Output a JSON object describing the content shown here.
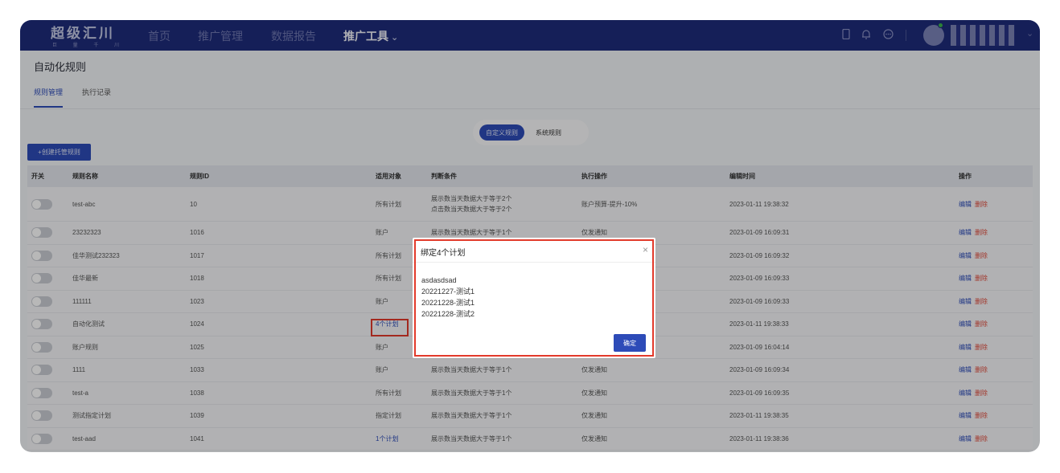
{
  "logo": {
    "main": "超级汇川",
    "sub": "巨 量 千 川"
  },
  "nav": {
    "items": [
      "首页",
      "推广管理",
      "数据报告"
    ],
    "active": "推广工具",
    "chevron": "chevron-down-icon"
  },
  "page": {
    "title": "自动化规则"
  },
  "subtabs": [
    "规则管理",
    "执行记录"
  ],
  "segment": {
    "custom": "自定义规则",
    "system": "系统规则"
  },
  "create_button": "+创建托管规则",
  "table": {
    "headers": [
      "开关",
      "规则名称",
      "规则ID",
      "适用对象",
      "判断条件",
      "执行操作",
      "编辑时间",
      "操作"
    ],
    "rows": [
      {
        "name": "test-abc",
        "id": "10",
        "target": "所有计划",
        "cond": [
          "展示数当天数据大于等于2个",
          "点击数当天数据大于等于2个"
        ],
        "action": "账户预算-提升-10%",
        "time": "2023-01-11 19:38:32"
      },
      {
        "name": "23232323",
        "id": "1016",
        "target": "账户",
        "cond": [
          "展示数当天数据大于等于1个"
        ],
        "action": "仅发通知",
        "time": "2023-01-09 16:09:31"
      },
      {
        "name": "佳华测试232323",
        "id": "1017",
        "target": "所有计划",
        "cond": [
          ""
        ],
        "action": "",
        "time": "2023-01-09 16:09:32"
      },
      {
        "name": "佳华最新",
        "id": "1018",
        "target": "所有计划",
        "cond": [
          ""
        ],
        "action": "",
        "time": "2023-01-09 16:09:33"
      },
      {
        "name": "111111",
        "id": "1023",
        "target": "账户",
        "cond": [
          ""
        ],
        "action": "",
        "time": "2023-01-09 16:09:33"
      },
      {
        "name": "自动化测试",
        "id": "1024",
        "target": "4个计划",
        "cond": [
          ""
        ],
        "action": "",
        "time": "2023-01-11 19:38:33"
      },
      {
        "name": "账户规则",
        "id": "1025",
        "target": "账户",
        "cond": [
          ""
        ],
        "action": "",
        "time": "2023-01-09 16:04:14"
      },
      {
        "name": "1111",
        "id": "1033",
        "target": "账户",
        "cond": [
          "展示数当天数据大于等于1个"
        ],
        "action": "仅发通知",
        "time": "2023-01-09 16:09:34"
      },
      {
        "name": "test-a",
        "id": "1038",
        "target": "所有计划",
        "cond": [
          "展示数当天数据大于等于1个"
        ],
        "action": "仅发通知",
        "time": "2023-01-09 16:09:35"
      },
      {
        "name": "测试指定计划",
        "id": "1039",
        "target": "指定计划",
        "cond": [
          "展示数当天数据大于等于1个"
        ],
        "action": "仅发通知",
        "time": "2023-01-11 19:38:35"
      },
      {
        "name": "test-aad",
        "id": "1041",
        "target": "1个计划",
        "cond": [
          "展示数当天数据大于等于1个"
        ],
        "action": "仅发通知",
        "time": "2023-01-11 19:38:36"
      }
    ],
    "edit_label": "编辑",
    "delete_label": "删除"
  },
  "modal": {
    "title": "绑定4个计划",
    "items": [
      "asdasdsad",
      "20221227-测试1",
      "20221228-测试1",
      "20221228-测试2"
    ],
    "ok": "确定"
  },
  "colors": {
    "nav_bg": "#1e2b7a",
    "accent": "#2d4bb8",
    "danger": "#e04a3b",
    "highlight": "#e23a2b"
  }
}
